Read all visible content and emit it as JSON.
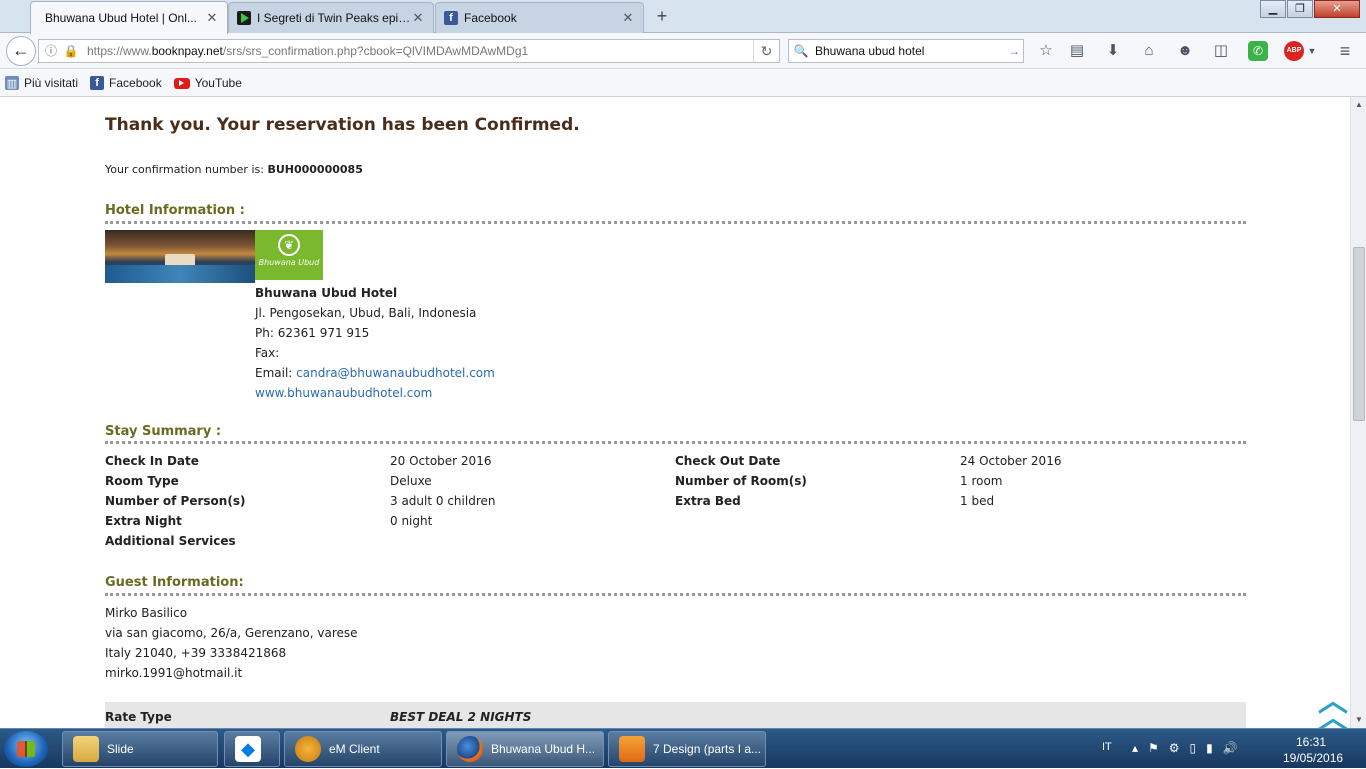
{
  "browser": {
    "tabs": [
      {
        "title": "Bhuwana Ubud Hotel | Onl...",
        "favicon": "hotel-favicon",
        "active": true
      },
      {
        "title": "I Segreti di Twin Peaks epis...",
        "favicon": "play-favicon",
        "active": false
      },
      {
        "title": "Facebook",
        "favicon": "facebook-favicon",
        "active": false
      }
    ],
    "new_tab_label": "+",
    "close_label": "✕",
    "url": {
      "prefix": "https://www.",
      "domain": "booknpay.net",
      "path": "/srs/srs_confirmation.php?cbook=QlVIMDAwMDAwMDg1"
    },
    "search_value": "Bhuwana ubud hotel",
    "bookmarks": [
      {
        "label": "Più visitati",
        "icon": "most-visited-icon"
      },
      {
        "label": "Facebook",
        "icon": "facebook-icon"
      },
      {
        "label": "YouTube",
        "icon": "youtube-icon"
      }
    ]
  },
  "page": {
    "heading": "Thank you. Your reservation has been Confirmed.",
    "confirmation_prefix": "Your confirmation number is: ",
    "confirmation_number": "BUH000000085",
    "hotel_section_title": "Hotel Information :",
    "hotel": {
      "logo_text": "Bhuwana Ubud",
      "name": "Bhuwana Ubud Hotel",
      "address": "Jl. Pengosekan, Ubud, Bali, Indonesia",
      "phone": "Ph: 62361 971 915",
      "fax": "Fax:",
      "email_label": "Email: ",
      "email": "candra@bhuwanaubudhotel.com",
      "website": "www.bhuwanaubudhotel.com"
    },
    "stay_section_title": "Stay Summary :",
    "stay": {
      "check_in_label": "Check In Date",
      "check_in_value": "20 October 2016",
      "check_out_label": "Check Out Date",
      "check_out_value": "24 October 2016",
      "room_type_label": "Room Type",
      "room_type_value": "Deluxe",
      "num_rooms_label": "Number of Room(s)",
      "num_rooms_value": "1 room",
      "persons_label": "Number of Person(s)",
      "persons_value": "3 adult 0 children",
      "extra_bed_label": "Extra Bed",
      "extra_bed_value": "1 bed",
      "extra_night_label": "Extra Night",
      "extra_night_value": "0 night",
      "additional_label": "Additional Services"
    },
    "guest_section_title": "Guest Information:",
    "guest": {
      "name": "Mirko Basilico",
      "street": "via san giacomo, 26/a, Gerenzano, varese",
      "country_phone": "Italy 21040, +39 3338421868",
      "email": "mirko.1991@hotmail.it"
    },
    "rate_type_label": "Rate Type",
    "rate_type_value": "BEST DEAL 2 NIGHTS"
  },
  "taskbar": {
    "tasks": [
      {
        "label": "Slide",
        "icon": "folder-icon"
      },
      {
        "label": "",
        "icon": "dropbox-icon"
      },
      {
        "label": "eM Client",
        "icon": "emclient-icon"
      },
      {
        "label": "Bhuwana Ubud H...",
        "icon": "firefox-icon"
      },
      {
        "label": "7 Design (parts I a...",
        "icon": "pdf-icon"
      }
    ],
    "language": "IT",
    "time": "16:31",
    "date": "19/05/2016"
  },
  "colors": {
    "heading": "#4a2e1a",
    "section_title": "#6a6a22",
    "link": "#2a6ab3"
  }
}
